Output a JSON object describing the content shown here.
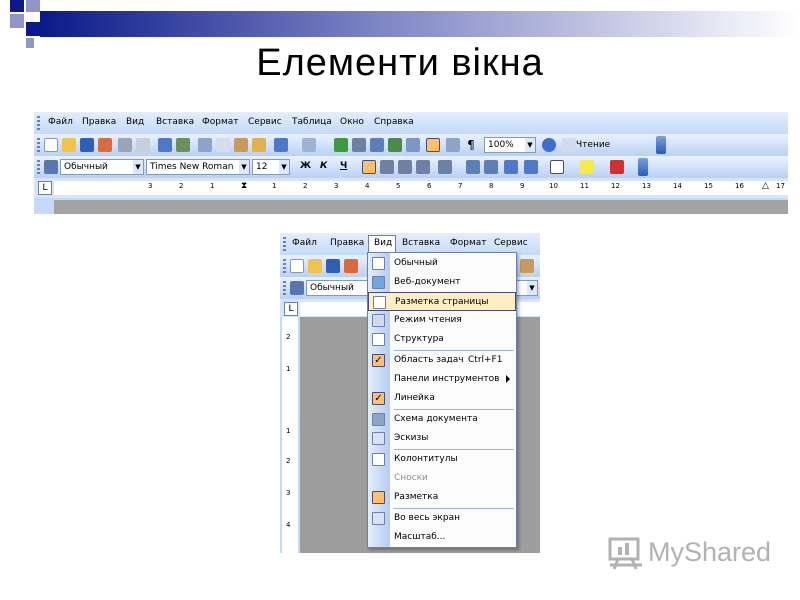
{
  "slide": {
    "title": "Елементи вікна",
    "accent_colors": {
      "dark_blue": "#0b1a8a",
      "light_blue": "#7e86c4"
    }
  },
  "main_window": {
    "menu": [
      "Файл",
      "Правка",
      "Вид",
      "Вставка",
      "Формат",
      "Сервис",
      "Таблица",
      "Окно",
      "Справка"
    ],
    "zoom": "100%",
    "reading_button": "Чтение",
    "style_combo": "Обычный",
    "font_combo": "Times New Roman",
    "size_combo": "12",
    "format_buttons": {
      "bold": "Ж",
      "italic": "К",
      "underline": "Ч"
    },
    "ruler_marks": [
      "3",
      "2",
      "1",
      "1",
      "2",
      "3",
      "4",
      "5",
      "6",
      "7",
      "8",
      "9",
      "10",
      "11",
      "12",
      "13",
      "14",
      "15",
      "16",
      "17"
    ],
    "ruler_tab_icon": "L"
  },
  "second_window": {
    "menu": [
      "Файл",
      "Правка",
      "Вид",
      "Вставка",
      "Формат",
      "Сервис"
    ],
    "style_combo": "Обычный",
    "ruler_tab_icon": "L",
    "vruler_marks": [
      "2",
      "1",
      "1",
      "2",
      "3",
      "4"
    ],
    "view_menu": {
      "items": [
        {
          "label": "Обычный",
          "icon": "normal-view-icon"
        },
        {
          "label": "Веб-документ",
          "icon": "web-view-icon"
        },
        {
          "label": "Разметка страницы",
          "icon": "page-layout-icon",
          "highlighted": true
        },
        {
          "label": "Режим чтения",
          "icon": "reading-mode-icon"
        },
        {
          "label": "Структура",
          "icon": "outline-icon"
        },
        {
          "label": "Область задач",
          "shortcut": "Ctrl+F1",
          "icon": "check-icon",
          "checked": true
        },
        {
          "label": "Панели инструментов",
          "icon": "",
          "submenu": true
        },
        {
          "label": "Линейка",
          "icon": "check-icon",
          "checked": true
        },
        {
          "label": "Схема документа",
          "icon": "document-map-icon"
        },
        {
          "label": "Эскизы",
          "icon": "thumbnails-icon"
        },
        {
          "label": "Колонтитулы",
          "icon": "header-footer-icon"
        },
        {
          "label": "Сноски",
          "icon": "",
          "disabled": true
        },
        {
          "label": "Разметка",
          "icon": "markup-icon"
        },
        {
          "label": "Во весь экран",
          "icon": "full-screen-icon"
        },
        {
          "label": "Масштаб...",
          "icon": ""
        }
      ]
    }
  },
  "logo": {
    "text": "MyShared"
  }
}
